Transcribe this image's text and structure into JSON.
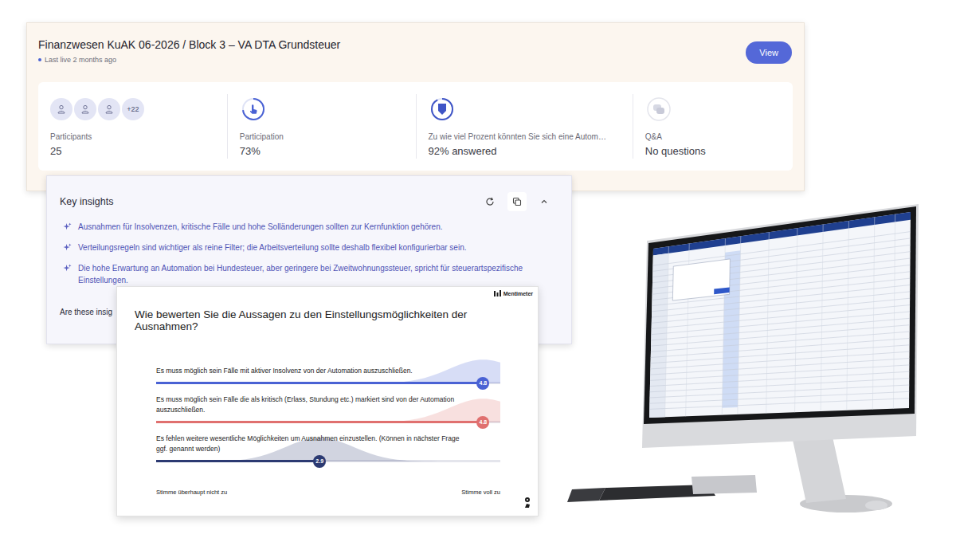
{
  "session_card": {
    "title": "Finanzwesen KuAK 06-2026 / Block 3 – VA DTA Grundsteuer",
    "status": "Last live 2 months ago",
    "view_button": "View",
    "stats": [
      {
        "kind": "avatars",
        "avatars": 3,
        "more": "+22",
        "label": "Participants",
        "value": "25"
      },
      {
        "kind": "participation",
        "level": 0.73,
        "label": "Participation",
        "value": "73%"
      },
      {
        "kind": "question",
        "level": 0.92,
        "label": "Zu wie viel Prozent könnten Sie sich eine Autom…",
        "value": "92% answered"
      },
      {
        "kind": "qa",
        "label": "Q&A",
        "value": "No questions"
      }
    ]
  },
  "insights": {
    "title": "Key insights",
    "items": [
      "Ausnahmen für Insolvenzen, kritische Fälle und hohe Solländerungen sollten zur Kernfunktion gehören.",
      "Verteilungsregeln sind wichtiger als reine Filter; die Arbeitsverteilung sollte deshalb flexibel konfigurierbar sein.",
      "Die hohe Erwartung an Automation bei Hundesteuer, aber geringere bei Zweitwohnungssteuer, spricht für steuerartspezifische Einstellungen."
    ],
    "feedback": "Are these insig"
  },
  "slide": {
    "brand": "Mentimeter",
    "question": "Wie bewerten Sie die Aussagen zu den Einstellungsmöglichkeiten der Ausnahmen?",
    "statements": [
      {
        "text": "Es muss möglich sein Fälle mit aktiver Insolvenz von der Automation auszuschließen.",
        "value": "4.8",
        "level": 0.95,
        "color": "#4a62d4"
      },
      {
        "text": "Es muss möglich sein Fälle die als kritisch (Erlass, Stundung etc.) markiert sind von der Automation auszuschließen.",
        "value": "4.8",
        "level": 0.95,
        "color": "#e0706f"
      },
      {
        "text": "Es fehlen weitere wesentliche Möglichkeiten um Ausnahmen einzustellen. (Können in nächster Frage ggf. genannt werden)",
        "value": "2.9",
        "level": 0.475,
        "color": "#2c3a72"
      }
    ],
    "scale_min": "Stimme überhaupt nicht zu",
    "scale_max": "Stimme voll zu"
  }
}
